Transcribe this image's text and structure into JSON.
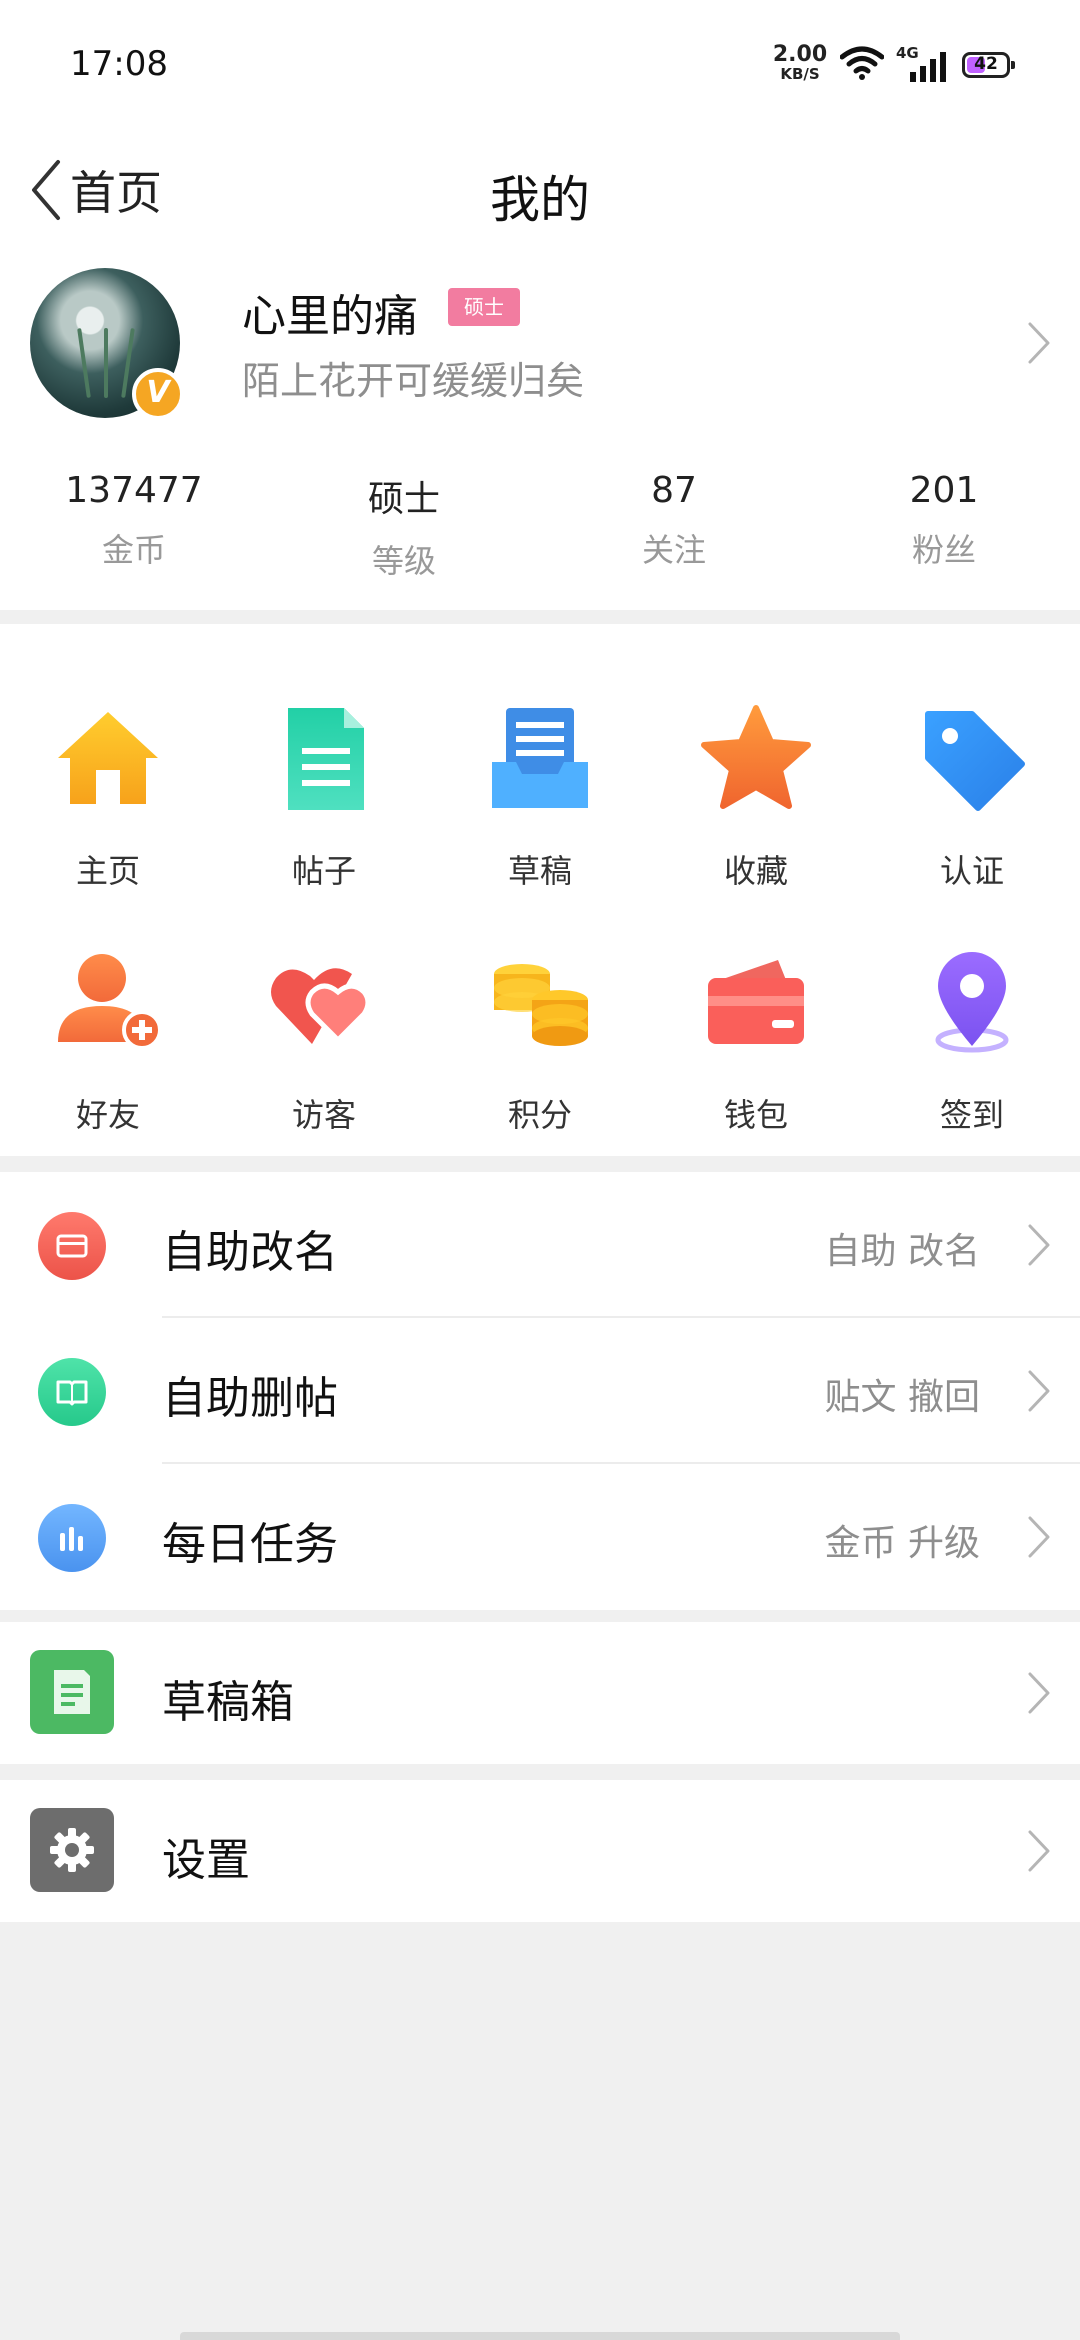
{
  "status_bar": {
    "time": "17:08",
    "net_speed": "2.00",
    "net_unit": "KB/S",
    "network": "4G",
    "battery": "42"
  },
  "nav": {
    "back_label": "首页",
    "title": "我的"
  },
  "profile": {
    "name": "心里的痛",
    "level_tag": "硕士",
    "signature": "陌上花开可缓缓归矣",
    "verified_badge": "V"
  },
  "stats": [
    {
      "value": "137477",
      "label": "金币"
    },
    {
      "value": "硕士",
      "label": "等级"
    },
    {
      "value": "87",
      "label": "关注"
    },
    {
      "value": "201",
      "label": "粉丝"
    }
  ],
  "grid": [
    {
      "label": "主页",
      "icon": "home-icon"
    },
    {
      "label": "帖子",
      "icon": "document-icon"
    },
    {
      "label": "草稿",
      "icon": "draft-tray-icon"
    },
    {
      "label": "收藏",
      "icon": "star-icon"
    },
    {
      "label": "认证",
      "icon": "tag-icon"
    },
    {
      "label": "好友",
      "icon": "add-friend-icon"
    },
    {
      "label": "访客",
      "icon": "hearts-icon"
    },
    {
      "label": "积分",
      "icon": "coins-icon"
    },
    {
      "label": "钱包",
      "icon": "wallet-icon"
    },
    {
      "label": "签到",
      "icon": "location-pin-icon"
    }
  ],
  "list": [
    {
      "title": "自助改名",
      "subtitle": "自助  改名",
      "icon": "card-icon",
      "color": "#f0655d"
    },
    {
      "title": "自助删帖",
      "subtitle": "贴文  撤回",
      "icon": "book-icon",
      "color": "#35d69b"
    },
    {
      "title": "每日任务",
      "subtitle": "金币  升级",
      "icon": "bar-chart-icon",
      "color": "#5aa3f5"
    }
  ],
  "drafts_box": {
    "title": "草稿箱",
    "icon": "draft-box-icon",
    "color": "#4cb963"
  },
  "settings": {
    "title": "设置",
    "icon": "gear-icon",
    "color": "#6d6d6d"
  }
}
